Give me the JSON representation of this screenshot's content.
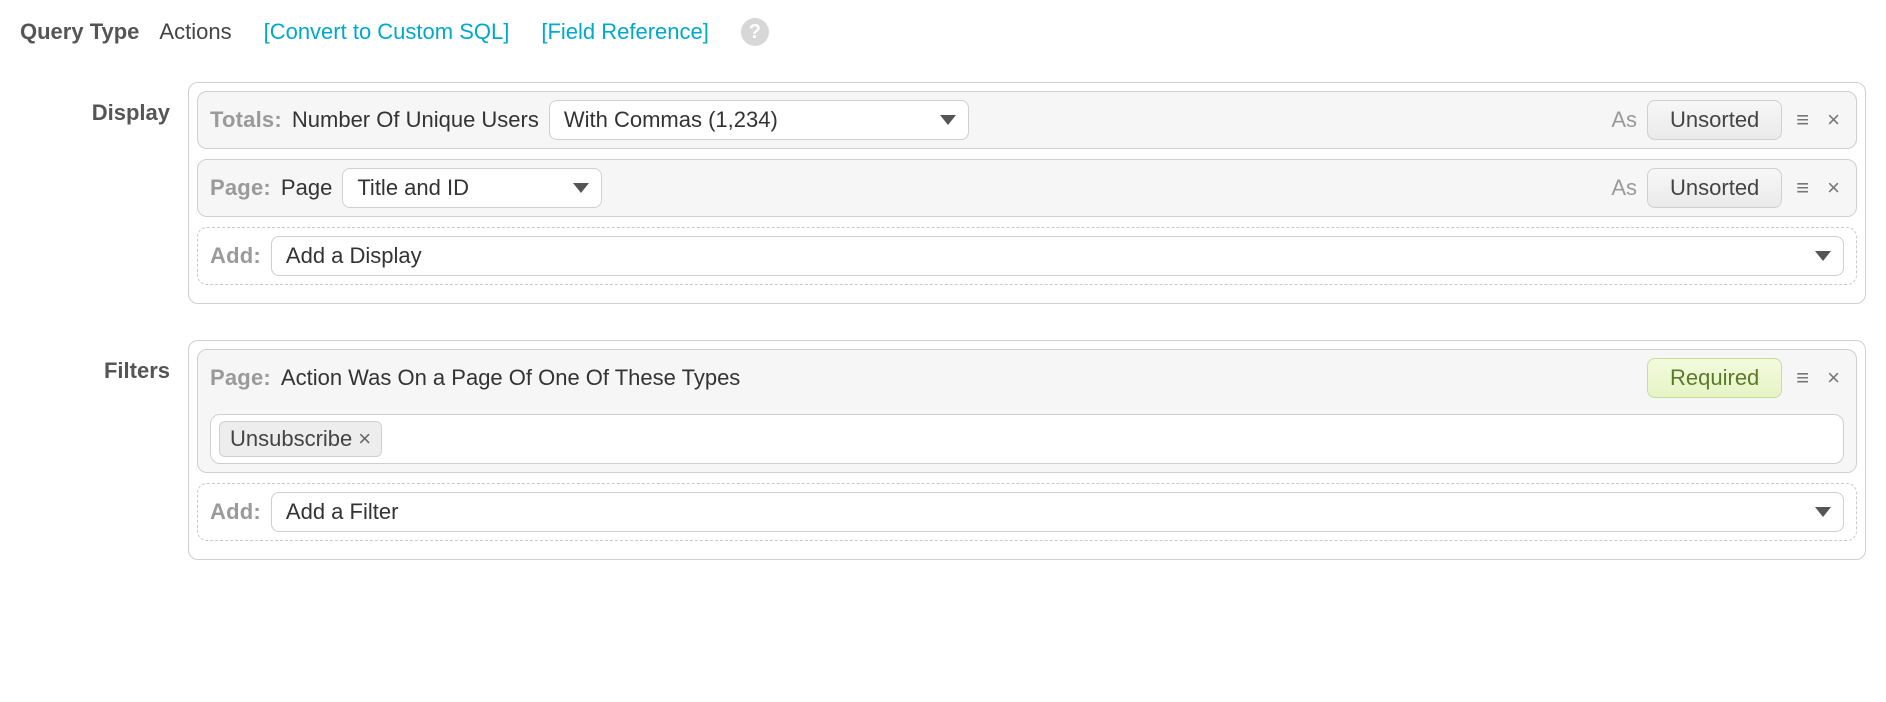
{
  "top": {
    "label": "Query Type",
    "value": "Actions",
    "convert_link": "[Convert to Custom SQL]",
    "field_ref_link": "[Field Reference]",
    "help_glyph": "?"
  },
  "display": {
    "section_label": "Display",
    "rows": [
      {
        "prefix_bold": "Totals:",
        "prefix_text": "Number Of Unique Users",
        "select_value": "With Commas (1,234)",
        "as_label": "As",
        "sort_button": "Unsorted"
      },
      {
        "prefix_bold": "Page:",
        "prefix_text": "Page",
        "select_value": "Title and ID",
        "as_label": "As",
        "sort_button": "Unsorted"
      }
    ],
    "add": {
      "prefix": "Add:",
      "placeholder": "Add a Display"
    }
  },
  "filters": {
    "section_label": "Filters",
    "row": {
      "prefix_bold": "Page:",
      "prefix_text": "Action Was On a Page Of One Of These Types",
      "badge": "Required",
      "tag": "Unsubscribe"
    },
    "add": {
      "prefix": "Add:",
      "placeholder": "Add a Filter"
    }
  }
}
